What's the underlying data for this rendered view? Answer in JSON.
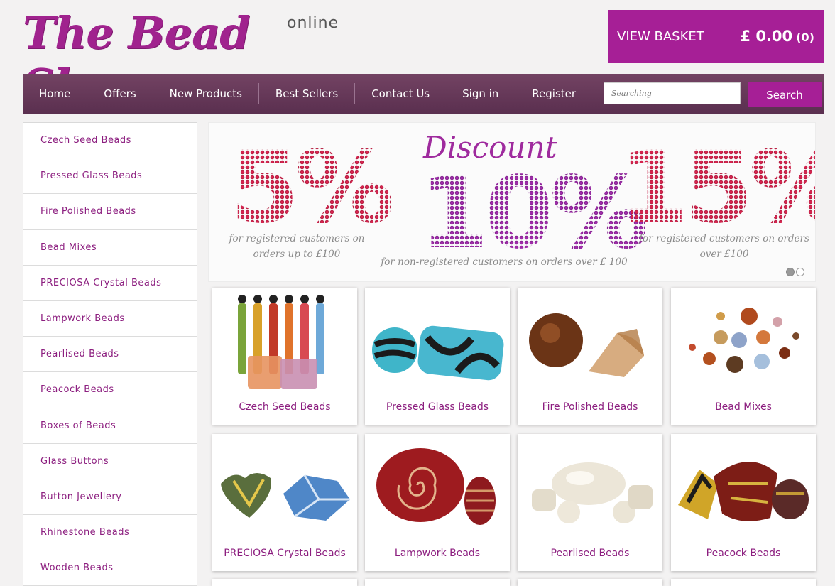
{
  "header": {
    "logo_text": "The Bead Shop",
    "logo_sub": "online",
    "basket_label": "VIEW BASKET",
    "basket_total": "£ 0.00",
    "basket_count": "(0)"
  },
  "nav": {
    "items": [
      "Home",
      "Offers",
      "New Products",
      "Best Sellers",
      "Contact Us",
      "Sign in",
      "Register"
    ],
    "search_placeholder": "Searching",
    "search_button": "Search"
  },
  "sidebar": {
    "items": [
      "Czech Seed Beads",
      "Pressed Glass Beads",
      "Fire Polished Beads",
      "Bead Mixes",
      "PRECIOSA Crystal Beads",
      "Lampwork Beads",
      "Pearlised Beads",
      "Peacock Beads",
      "Boxes of Beads",
      "Glass Buttons",
      "Button Jewellery",
      "Rhinestone Beads",
      "Wooden Beads"
    ]
  },
  "banner": {
    "left_value": "5%",
    "left_caption_1": "for registered customers on",
    "left_caption_2": "orders up to £100",
    "center_title": "Discount",
    "center_value": "10%",
    "center_caption": "for non-registered customers on orders over £ 100",
    "right_value": "15%",
    "right_caption_1": "for registered customers on orders",
    "right_caption_2": "over £100",
    "slides": 2,
    "active_slide": 1
  },
  "products": [
    {
      "label": "Czech Seed Beads",
      "icon": "seed-beads-tubes-image"
    },
    {
      "label": "Pressed Glass Beads",
      "icon": "pressed-glass-beads-image"
    },
    {
      "label": "Fire Polished Beads",
      "icon": "fire-polished-beads-image"
    },
    {
      "label": "Bead Mixes",
      "icon": "bead-mix-image"
    },
    {
      "label": "PRECIOSA Crystal Beads",
      "icon": "crystal-beads-image"
    },
    {
      "label": "Lampwork Beads",
      "icon": "lampwork-beads-image"
    },
    {
      "label": "Pearlised Beads",
      "icon": "pearl-beads-image"
    },
    {
      "label": "Peacock Beads",
      "icon": "peacock-beads-image"
    }
  ],
  "colors": {
    "brand": "#a61f96",
    "nav": "#5e3353",
    "link": "#8c1e7f"
  }
}
